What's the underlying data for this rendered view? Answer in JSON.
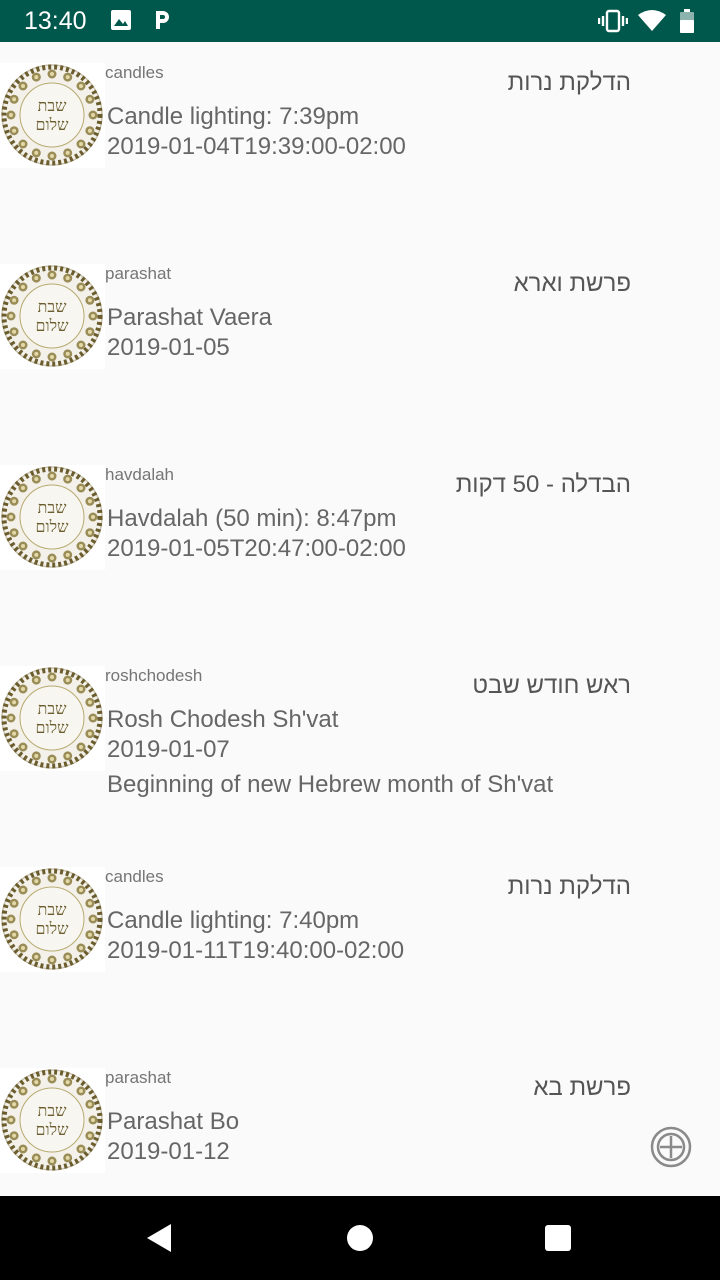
{
  "status_bar": {
    "time": "13:40",
    "left_icons": [
      "image-icon",
      "p-icon"
    ],
    "right_icons": [
      "vibrate-icon",
      "wifi-icon",
      "battery-icon"
    ],
    "background": "#00574b"
  },
  "events": [
    {
      "category": "candles",
      "hebrew": "הדלקת נרות",
      "title": "Candle lighting: 7:39pm",
      "date": "2019-01-04T19:39:00-02:00",
      "memo": "",
      "thumbnail_text": [
        "שבת",
        "שלום"
      ]
    },
    {
      "category": "parashat",
      "hebrew": "פרשת וארא",
      "title": "Parashat Vaera",
      "date": "2019-01-05",
      "memo": "",
      "thumbnail_text": [
        "שבת",
        "שלום"
      ]
    },
    {
      "category": "havdalah",
      "hebrew": "הבדלה - 50 דקות",
      "title": "Havdalah (50 min): 8:47pm",
      "date": "2019-01-05T20:47:00-02:00",
      "memo": "",
      "thumbnail_text": [
        "שבת",
        "שלום"
      ]
    },
    {
      "category": "roshchodesh",
      "hebrew": "ראש חודש שבט",
      "title": "Rosh Chodesh Sh'vat",
      "date": "2019-01-07",
      "memo": "Beginning of new Hebrew month of Sh'vat",
      "thumbnail_text": [
        "שבת",
        "שלום"
      ]
    },
    {
      "category": "candles",
      "hebrew": "הדלקת נרות",
      "title": "Candle lighting: 7:40pm",
      "date": "2019-01-11T19:40:00-02:00",
      "memo": "",
      "thumbnail_text": [
        "שבת",
        "שלום"
      ]
    },
    {
      "category": "parashat",
      "hebrew": "פרשת בא",
      "title": "Parashat Bo",
      "date": "2019-01-12",
      "memo": "",
      "thumbnail_text": [
        "שבת",
        "שלום"
      ]
    }
  ],
  "fab": {
    "icon": "add-circle-icon"
  },
  "nav_bar": {
    "buttons": [
      "back-icon",
      "home-icon",
      "recents-icon"
    ]
  }
}
